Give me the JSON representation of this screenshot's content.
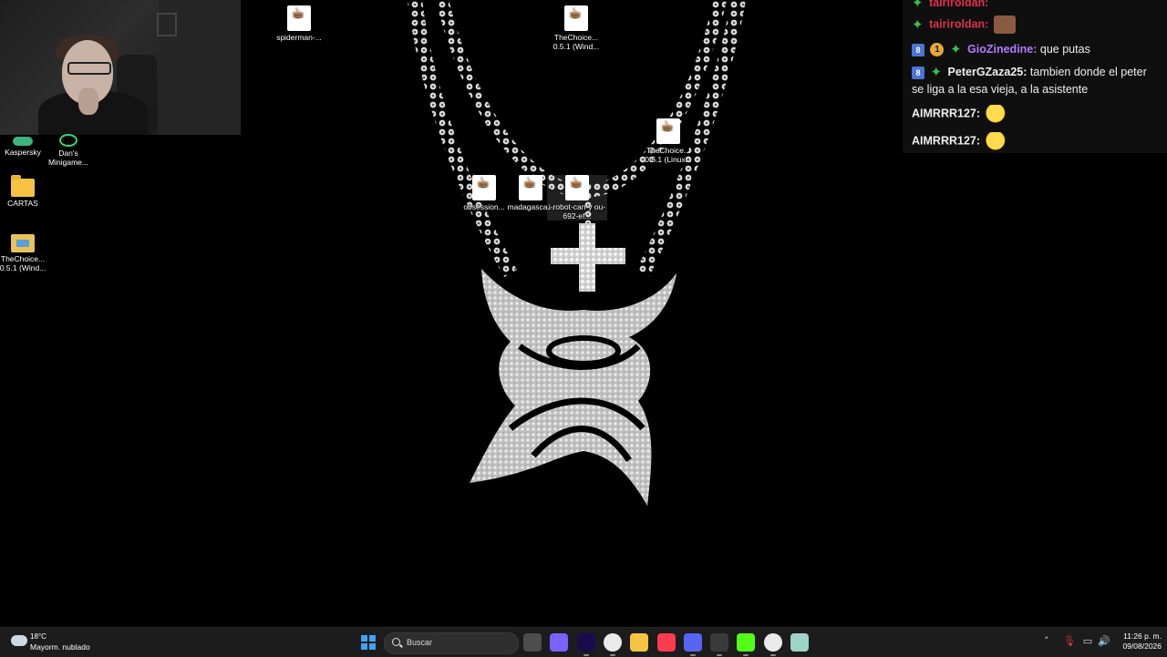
{
  "desktop": {
    "icons": {
      "kaspersky": "Kaspersky",
      "dans": "Dan's Minigame...",
      "cartas": "CARTAS",
      "thechoice_left": "TheChoice... 0.5.1 (Wind...",
      "spiderman": "spiderman-...",
      "thechoice_top": "TheChoice... 0.5.1 (Wind...",
      "thechoice_right": "TheChoice... 0.5.1 (Linux...",
      "obsession": "obsession...",
      "madagascar": "madagasca...",
      "irobot": "i-robot-can-y ou-692-ef..."
    }
  },
  "chat": {
    "messages": [
      {
        "user": "tairiroldan:",
        "text": "",
        "user_color": "#e0304a"
      },
      {
        "user": "GioZinedine:",
        "text": "que putas",
        "user_color": "#b07cff"
      },
      {
        "user": "PeterGZaza25:",
        "text": "tambien donde el peter se liga a la esa vieja, a la asistente",
        "user_color": "#efeff1"
      },
      {
        "user": "AIMRRR127:",
        "text": "",
        "user_color": "#efeff1"
      },
      {
        "user": "AIMRRR127:",
        "text": "",
        "user_color": "#efeff1"
      }
    ]
  },
  "taskbar": {
    "weather_temp": "18°C",
    "weather_desc": "Mayorm. nublado",
    "search_placeholder": "Buscar",
    "apps": [
      {
        "name": "task-view",
        "color": "#4d4d4d"
      },
      {
        "name": "copilot",
        "color": "#7b61ff"
      },
      {
        "name": "premiere-pro",
        "color": "#1a0b4d"
      },
      {
        "name": "chrome",
        "color": "#eaeaea"
      },
      {
        "name": "file-explorer",
        "color": "#f6c343"
      },
      {
        "name": "music",
        "color": "#fa3c4c"
      },
      {
        "name": "discord",
        "color": "#5865f2"
      },
      {
        "name": "obs",
        "color": "#3a3a3a"
      },
      {
        "name": "kick",
        "color": "#53fc18"
      },
      {
        "name": "chrome-2",
        "color": "#eaeaea"
      },
      {
        "name": "notepad",
        "color": "#9fd3c7"
      }
    ],
    "clock_time": "11:26 p. m.",
    "clock_date": "09/08/2026"
  }
}
